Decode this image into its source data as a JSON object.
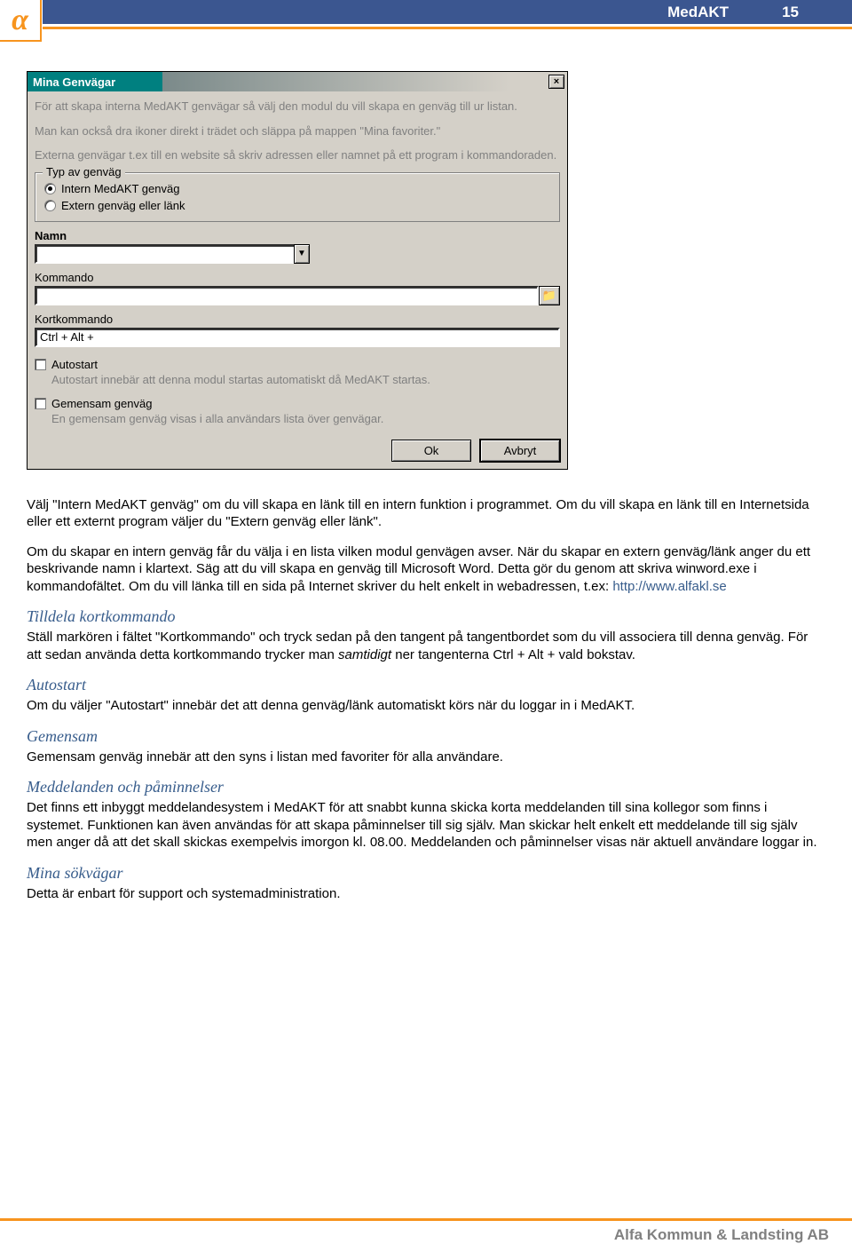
{
  "header": {
    "title": "MedAKT",
    "page_num": "15"
  },
  "dialog": {
    "title": "Mina Genvägar",
    "close_glyph": "×",
    "help1": "För att skapa interna MedAKT genvägar så välj den modul du vill skapa en genväg till ur listan.",
    "help2": "Man kan också dra ikoner direkt i trädet och släppa på mappen \"Mina favoriter.\"",
    "help3": "Externa genvägar t.ex till en website så skriv adressen eller namnet på ett program i kommandoraden.",
    "radio_legend": "Typ av genväg",
    "radio1": "Intern MedAKT genväg",
    "radio2": "Extern genväg eller länk",
    "namn_label": "Namn",
    "combo_glyph": "▼",
    "kommando_label": "Kommando",
    "browse_glyph": "📁",
    "kort_label": "Kortkommando",
    "kort_value": "Ctrl + Alt +",
    "autostart_label": "Autostart",
    "autostart_desc": "Autostart innebär att denna modul startas automatiskt då MedAKT startas.",
    "gemensam_label": "Gemensam genväg",
    "gemensam_desc": "En gemensam genväg visas i alla användars lista över genvägar.",
    "ok": "Ok",
    "cancel": "Avbryt"
  },
  "text": {
    "p1": "Välj \"Intern MedAKT genväg\" om du vill skapa en länk till en intern funktion i programmet. Om du vill skapa en länk till en Internetsida eller ett externt program väljer du \"Extern genväg eller länk\".",
    "p2a": "Om du skapar en intern genväg får du välja i en lista vilken modul genvägen avser. När du skapar en extern genväg/länk anger du ett beskrivande namn i klartext. Säg att du vill skapa en genväg till Microsoft Word. Detta gör du genom att skriva winword.exe i kommandofältet. Om du vill länka till en sida på Internet skriver du helt enkelt in webadressen, t.ex: ",
    "p2link": "http://www.alfakl.se",
    "h_tilldela": "Tilldela kortkommando",
    "p_tilldela_a": "Ställ markören i fältet \"Kortkommando\" och tryck sedan på den tangent på tangentbordet som du vill associera till denna genväg. För att sedan använda detta kortkommando trycker man ",
    "p_tilldela_i": "samtidigt",
    "p_tilldela_b": " ner tangenterna Ctrl + Alt + vald bokstav.",
    "h_autostart": "Autostart",
    "p_autostart": "Om du väljer \"Autostart\" innebär det att denna genväg/länk automatiskt körs när du loggar in i MedAKT.",
    "h_gemensam": "Gemensam",
    "p_gemensam": "Gemensam genväg innebär att den syns i listan med favoriter för alla användare.",
    "h_medd": "Meddelanden och påminnelser",
    "p_medd": "Det finns ett inbyggt meddelandesystem i MedAKT för att snabbt kunna skicka korta meddelanden till sina kollegor som finns i systemet. Funktionen kan även användas för att skapa påminnelser till sig själv. Man skickar helt enkelt ett meddelande till sig själv men anger då att det skall skickas exempelvis imorgon kl. 08.00. Meddelanden och påminnelser visas när aktuell användare loggar in.",
    "h_sok": "Mina sökvägar",
    "p_sok": "Detta är enbart för support och systemadministration."
  },
  "footer": {
    "text": "Alfa Kommun & Landsting AB"
  }
}
